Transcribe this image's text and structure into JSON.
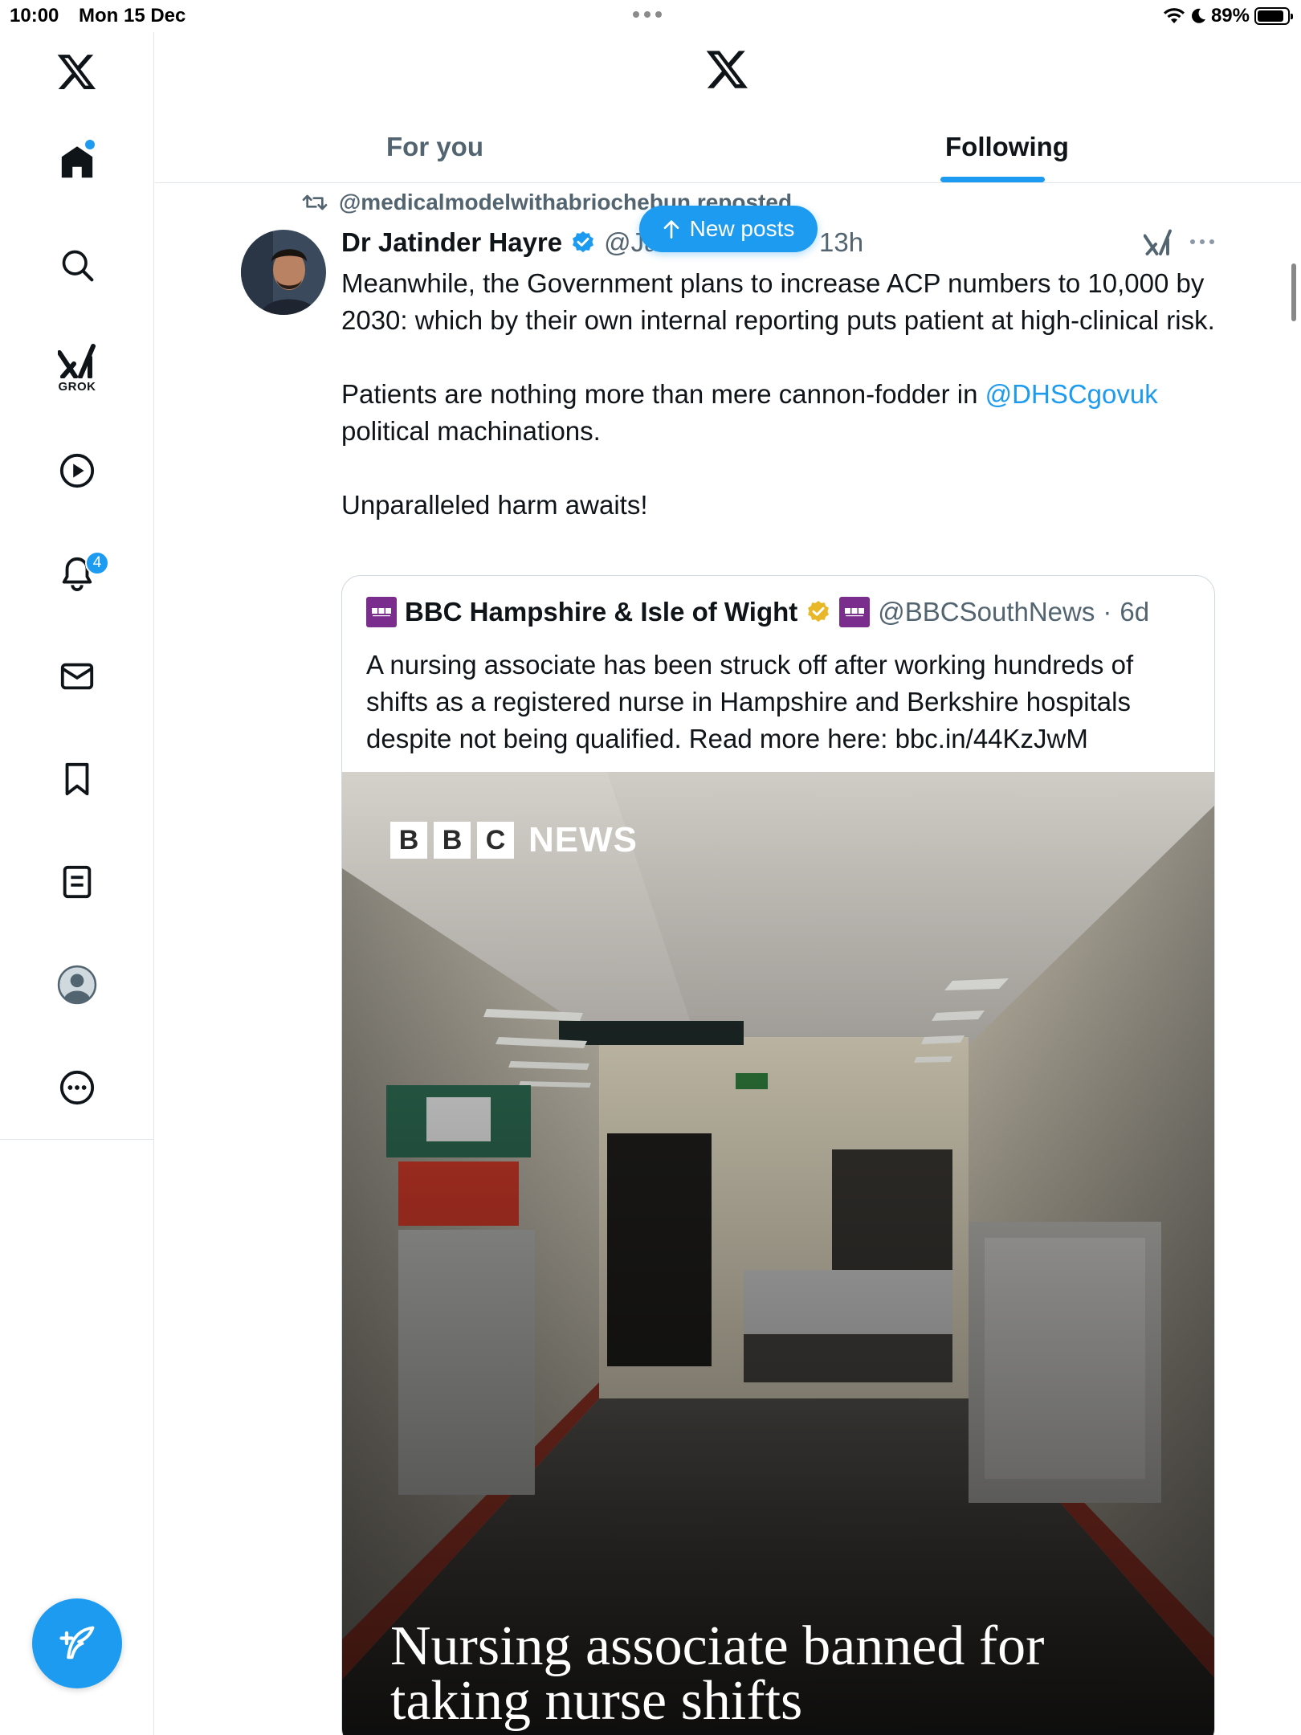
{
  "status_bar": {
    "time": "10:00",
    "date": "Mon 15 Dec",
    "battery": "89%",
    "battery_level": 0.89
  },
  "sidebar": {
    "items": [
      {
        "name": "home",
        "icon": "home-icon",
        "active": true,
        "has_dot": true
      },
      {
        "name": "explore",
        "icon": "search-icon"
      },
      {
        "name": "grok",
        "icon": "grok-icon",
        "label": "GROK"
      },
      {
        "name": "video",
        "icon": "play-icon"
      },
      {
        "name": "notifications",
        "icon": "bell-icon",
        "badge": "4"
      },
      {
        "name": "messages",
        "icon": "mail-icon"
      },
      {
        "name": "bookmarks",
        "icon": "bookmark-icon"
      },
      {
        "name": "lists",
        "icon": "list-icon"
      },
      {
        "name": "profile",
        "icon": "profile-avatar-icon"
      },
      {
        "name": "more",
        "icon": "more-circle-icon"
      }
    ]
  },
  "header": {
    "tabs": [
      {
        "label": "For you",
        "active": false
      },
      {
        "label": "Following",
        "active": true
      }
    ]
  },
  "new_posts": {
    "label": "New posts"
  },
  "post": {
    "repost_by": "@medicalmodelwithabriochebun reposted",
    "author_name": "Dr Jatinder Hayre",
    "author_handle": "@Ja",
    "time": "13h",
    "paragraphs": {
      "p1": "Meanwhile, the Government plans to increase ACP numbers to 10,000 by 2030: which by their own internal reporting puts patient at high-clinical risk.",
      "p2_before": "Patients are nothing more than mere cannon-fodder in ",
      "p2_link": "@DHSCgovuk",
      "p2_after": " political machinations.",
      "p3": "Unparalleled harm awaits!"
    },
    "quote": {
      "name": "BBC Hampshire & Isle of Wight",
      "handle": "@BBCSouthNews",
      "separator": "·",
      "time": "6d",
      "text": "A nursing associate has been struck off after working hundreds of shifts as a registered nurse in Hampshire and Berkshire hospitals despite not being qualified. Read more here: bbc.in/44KzJwM",
      "image": {
        "logo_letters": [
          "B",
          "B",
          "C"
        ],
        "logo_word": "NEWS",
        "headline": "Nursing associate banned for taking nurse shifts"
      }
    }
  },
  "colors": {
    "accent": "#1d9bf0",
    "text": "#0f1419",
    "secondary": "#536471",
    "border": "#cfd9de",
    "verified_blue": "#1d9bf0",
    "verified_gold": "#e8b829",
    "bbc_purple": "#7b2d8e"
  }
}
